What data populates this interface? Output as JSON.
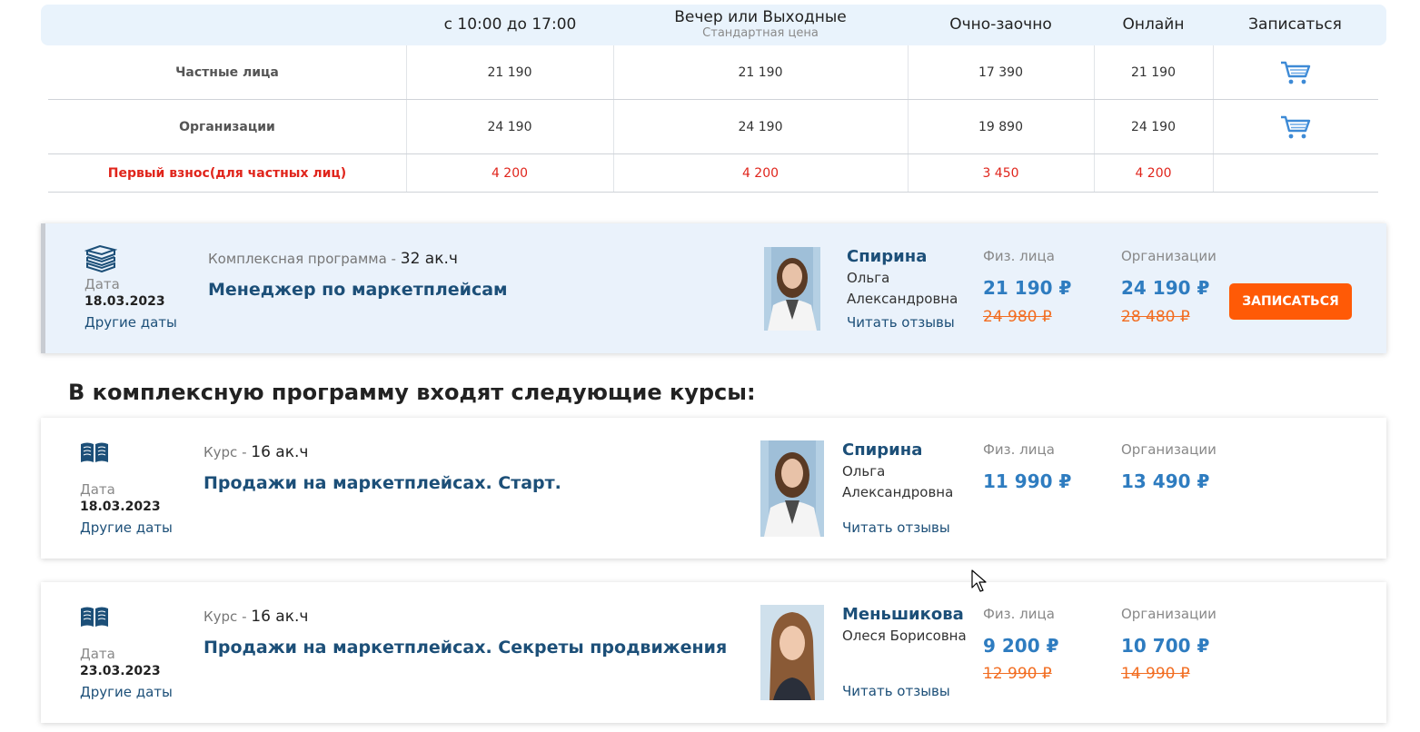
{
  "table": {
    "headers": [
      {
        "main": "с 10:00 до 17:00",
        "sub": ""
      },
      {
        "main": "Вечер или Выходные",
        "sub": "Стандартная цена"
      },
      {
        "main": "Очно-заочно",
        "sub": ""
      },
      {
        "main": "Онлайн",
        "sub": ""
      },
      {
        "main": "Записаться",
        "sub": ""
      }
    ],
    "rows": [
      {
        "label": "Частные лица",
        "values": [
          "21 190",
          "21 190",
          "17 390",
          "21 190"
        ],
        "cart": true
      },
      {
        "label": "Организации",
        "values": [
          "24 190",
          "24 190",
          "19 890",
          "24 190"
        ],
        "cart": true
      },
      {
        "label": "Первый взнос(для частных лиц)",
        "values": [
          "4 200",
          "4 200",
          "3 450",
          "4 200"
        ],
        "cart": false
      }
    ]
  },
  "main_course": {
    "kind": "Комплексная программа -",
    "hours": "32 ак.ч",
    "title": "Менеджер по маркетплейсам",
    "date_label": "Дата",
    "date": "18.03.2023",
    "other_dates": "Другие даты",
    "teacher_surname": "Спирина",
    "teacher_name": "Ольга Александровна",
    "reviews": "Читать отзывы",
    "price_individual_label": "Физ. лица",
    "price_individual": "21 190 ₽",
    "price_individual_old": "24 980 ₽",
    "price_org_label": "Организации",
    "price_org": "24 190 ₽",
    "price_org_old": "28 480 ₽",
    "enroll_label": "ЗАПИСАТЬСЯ"
  },
  "section_title": "В комплексную программу входят следующие курсы:",
  "courses": [
    {
      "kind": "Курс -",
      "hours": "16 ак.ч",
      "title": "Продажи на маркетплейсах. Старт.",
      "date_label": "Дата",
      "date": "18.03.2023",
      "other_dates": "Другие даты",
      "teacher_surname": "Спирина",
      "teacher_name": "Ольга Александровна",
      "reviews": "Читать отзывы",
      "price_individual_label": "Физ. лица",
      "price_individual": "11 990 ₽",
      "price_org_label": "Организации",
      "price_org": "13 490 ₽"
    },
    {
      "kind": "Курс -",
      "hours": "16 ак.ч",
      "title": "Продажи на маркетплейсах. Секреты продвижения",
      "date_label": "Дата",
      "date": "23.03.2023",
      "other_dates": "Другие даты",
      "teacher_surname": "Меньшикова",
      "teacher_name": "Олеся Борисовна",
      "reviews": "Читать отзывы",
      "price_individual_label": "Физ. лица",
      "price_individual": "9 200 ₽",
      "price_individual_old": "12 990 ₽",
      "price_org_label": "Организации",
      "price_org": "10 700 ₽",
      "price_org_old": "14 990 ₽"
    }
  ],
  "icons": {
    "books": "books-stack-icon",
    "book": "open-book-icon",
    "cart": "shopping-cart-icon",
    "cursor": "mouse-cursor-icon"
  },
  "colors": {
    "accent_blue": "#1c4f78",
    "price_blue": "#2e7cc0",
    "old_price_orange": "#f26d21",
    "button_orange": "#ff5a06",
    "first_payment_red": "#e0251c",
    "header_bg": "#e9f3fc"
  }
}
